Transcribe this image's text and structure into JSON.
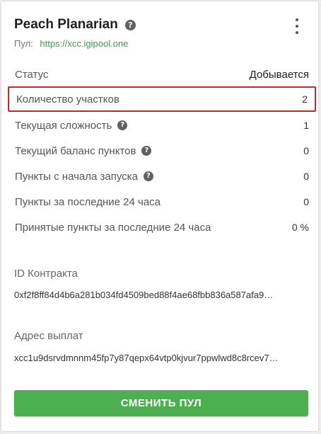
{
  "card": {
    "title": "Peach Planarian",
    "pool_label": "Пул:",
    "pool_url": "https://xcc.igipool.one"
  },
  "stats": [
    {
      "label": "Статус",
      "value": "Добывается",
      "help": false
    },
    {
      "label": "Количество участков",
      "value": "2",
      "help": false
    },
    {
      "label": "Текущая сложность",
      "value": "1",
      "help": true
    },
    {
      "label": "Текущий баланс пунктов",
      "value": "0",
      "help": true
    },
    {
      "label": "Пункты с начала запуска",
      "value": "0",
      "help": true
    },
    {
      "label": "Пункты за последние 24 часа",
      "value": "0",
      "help": false
    },
    {
      "label": "Принятые пункты за последние 24 часа",
      "value": "0 %",
      "help": false
    }
  ],
  "contract": {
    "label": "ID Контракта",
    "value": "0xf2f8ff84d4b6a281b034fd4509bed88f4ae68fbb836a587afa9…"
  },
  "payout": {
    "label": "Адрес выплат",
    "value": "xcc1u9dsrvdmnnm45fp7y87qepx64vtp0kjvur7ppwlwd8c8rcev7…"
  },
  "button": {
    "label": "СМЕНИТЬ ПУЛ"
  },
  "icons": {
    "help": "help-circle-icon",
    "menu": "more-vert-icon"
  },
  "colors": {
    "accent": "#4caf50",
    "link": "#3a9a4e",
    "highlight": "#c62828"
  }
}
